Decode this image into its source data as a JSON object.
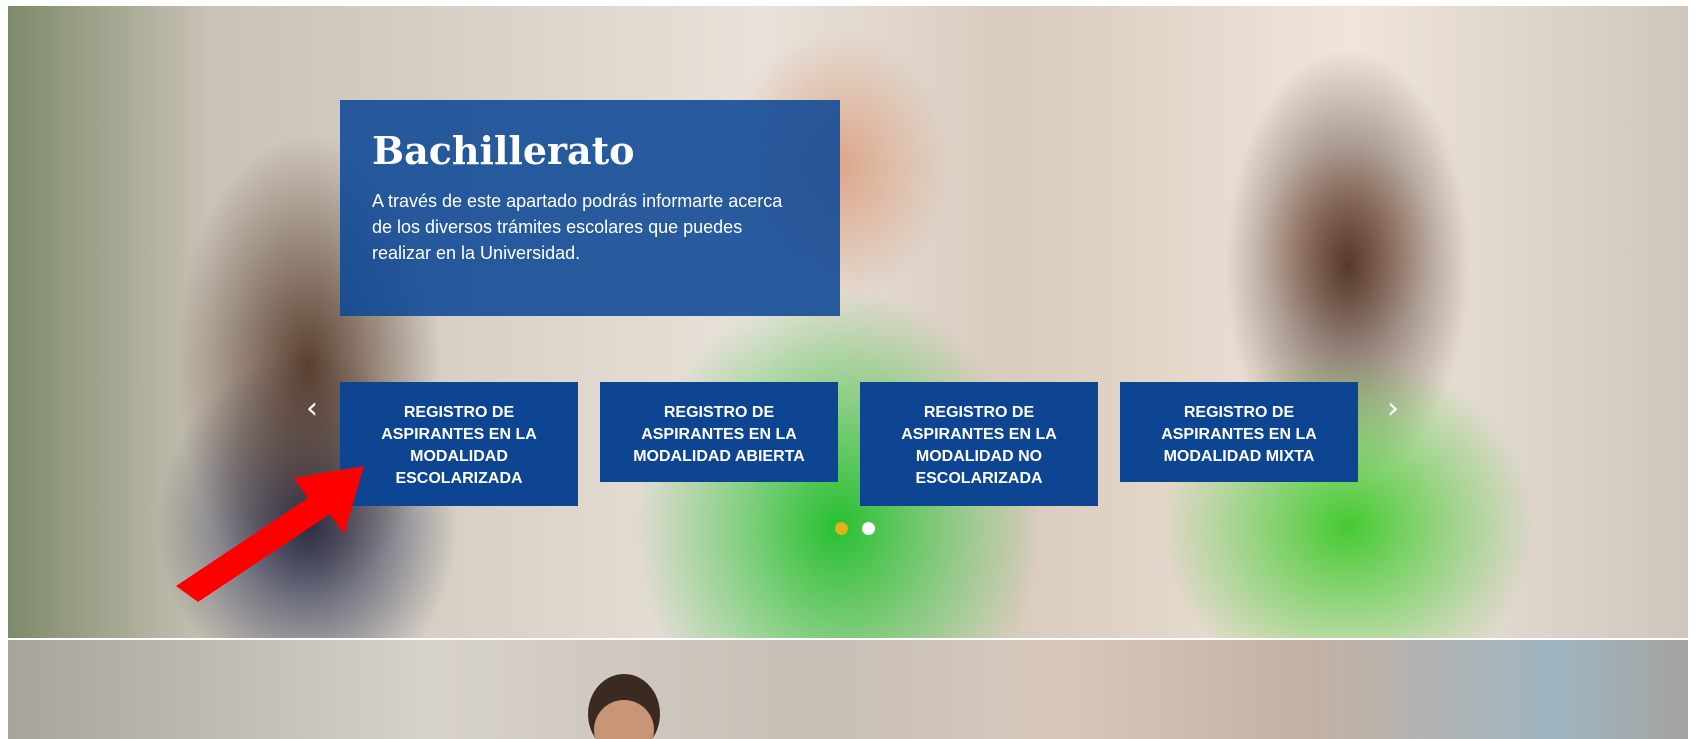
{
  "hero": {
    "panel": {
      "title": "Bachillerato",
      "text": "A través de este apartado podrás informarte acerca de los diversos trámites escolares que puedes realizar en la Universidad."
    },
    "buttons": [
      {
        "label": "REGISTRO DE ASPIRANTES EN LA MODALIDAD ESCOLARIZADA"
      },
      {
        "label": "REGISTRO DE ASPIRANTES EN LA MODALIDAD ABIERTA"
      },
      {
        "label": "REGISTRO DE ASPIRANTES EN LA MODALIDAD NO ESCOLARIZADA"
      },
      {
        "label": "REGISTRO DE ASPIRANTES EN LA MODALIDAD MIXTA"
      }
    ],
    "prev_icon": "chevron-left-icon",
    "next_icon": "chevron-right-icon",
    "prev_glyph": "‹",
    "next_glyph": "›",
    "slides_total": 2,
    "active_slide": 1
  },
  "colors": {
    "panel_blue": "#0e4896",
    "button_blue": "#0d4592",
    "dot_active": "#e0b21a",
    "annotation_arrow": "#ff0000"
  }
}
